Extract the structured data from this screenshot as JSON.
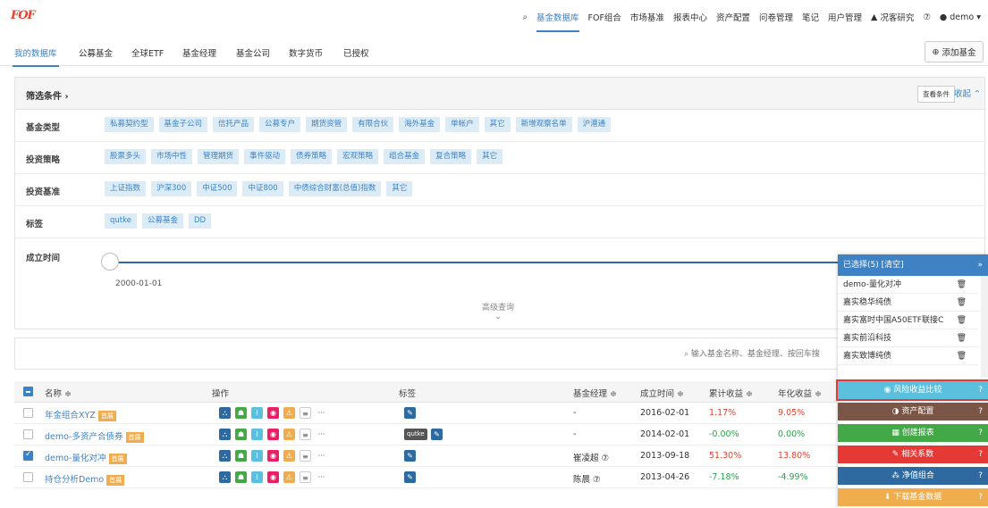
{
  "brand": {
    "logo": "FOF"
  },
  "topnav": {
    "items": [
      "基金数据库",
      "FOF组合",
      "市场基准",
      "报表中心",
      "资产配置",
      "问卷管理",
      "笔记",
      "用户管理",
      "况客研究"
    ],
    "user": "demo"
  },
  "subtabs": [
    "我的数据库",
    "公募基金",
    "全球ETF",
    "基金经理",
    "基金公司",
    "数字货币",
    "已授权"
  ],
  "add_fund": "添加基金",
  "filter": {
    "title": "筛选条件",
    "view_conditions": "查看条件",
    "collapse": "收起",
    "rows": [
      {
        "label": "基金类型",
        "chips": [
          "私募契约型",
          "基金子公司",
          "信托产品",
          "公募专户",
          "期货资管",
          "有限合伙",
          "海外基金",
          "单帐户",
          "其它",
          "新增观察名单",
          "沪港通"
        ]
      },
      {
        "label": "投资策略",
        "chips": [
          "股票多头",
          "市场中性",
          "管理期货",
          "事件驱动",
          "债券策略",
          "宏观策略",
          "组合基金",
          "复合策略",
          "其它"
        ]
      },
      {
        "label": "投资基准",
        "chips": [
          "上证指数",
          "沪深300",
          "中证500",
          "中证800",
          "中债综合财富(总值)指数",
          "其它"
        ]
      },
      {
        "label": "标签",
        "chips": [
          "qutke",
          "公募基金",
          "DD"
        ]
      }
    ],
    "date_label": "成立时间",
    "date_start": "2000-01-01",
    "advanced": "高级查询"
  },
  "search": {
    "placeholder": "输入基金名称、基金经理、按回车搜"
  },
  "table": {
    "headers": [
      "名称 ≑",
      "操作",
      "标签",
      "基金经理 ≑",
      "成立时间 ≑",
      "累计收益 ≑",
      "年化收益 ≑"
    ],
    "rows": [
      {
        "name": "年金组合XYZ",
        "badge": "首展",
        "tag": "",
        "manager": "-",
        "date": "2016-02-01",
        "cum": "1.17%",
        "ann": "9.05%",
        "checked": false,
        "cum_color": "red",
        "ann_color": "red"
      },
      {
        "name": "demo-多资产合债券",
        "badge": "首展",
        "tag": "qutke",
        "manager": "-",
        "date": "2014-02-01",
        "cum": "-0.00%",
        "ann": "0.00%",
        "checked": false,
        "cum_color": "green",
        "ann_color": "green"
      },
      {
        "name": "demo-量化对冲",
        "badge": "首展",
        "tag": "",
        "manager": "崔凌超 ⑦",
        "date": "2013-09-18",
        "cum": "51.30%",
        "ann": "13.80%",
        "checked": true,
        "cum_color": "red",
        "ann_color": "red"
      },
      {
        "name": "持仓分析Demo",
        "badge": "首展",
        "tag": "",
        "manager": "陈晨 ⑦",
        "date": "2013-04-26",
        "cum": "-7.18%",
        "ann": "-4.99%",
        "checked": false,
        "cum_color": "green",
        "ann_color": "green"
      }
    ]
  },
  "selected": {
    "head": "已选择(5) [清空]",
    "items": [
      "demo-量化对冲",
      "嘉实稳华纯债",
      "嘉实富时中国A50ETF联接C",
      "嘉实前沿科技",
      "嘉实致博纯债"
    ]
  },
  "actions": [
    {
      "label": "◉ 风险收益比较",
      "color": "#5bc0de"
    },
    {
      "label": "◑ 资产配置",
      "color": "#7b5546"
    },
    {
      "label": "▦ 创建报表",
      "color": "#43a947"
    },
    {
      "label": "✎ 相关系数",
      "color": "#e53935"
    },
    {
      "label": "⁂ 净值组合",
      "color": "#2e6aa0"
    },
    {
      "label": "⬇ 下载基金数据",
      "color": "#f0ad4e"
    }
  ],
  "op_colors": [
    "#2e6aa0",
    "#43a947",
    "#5bc0de",
    "#e91e63",
    "#f0ad4e"
  ]
}
